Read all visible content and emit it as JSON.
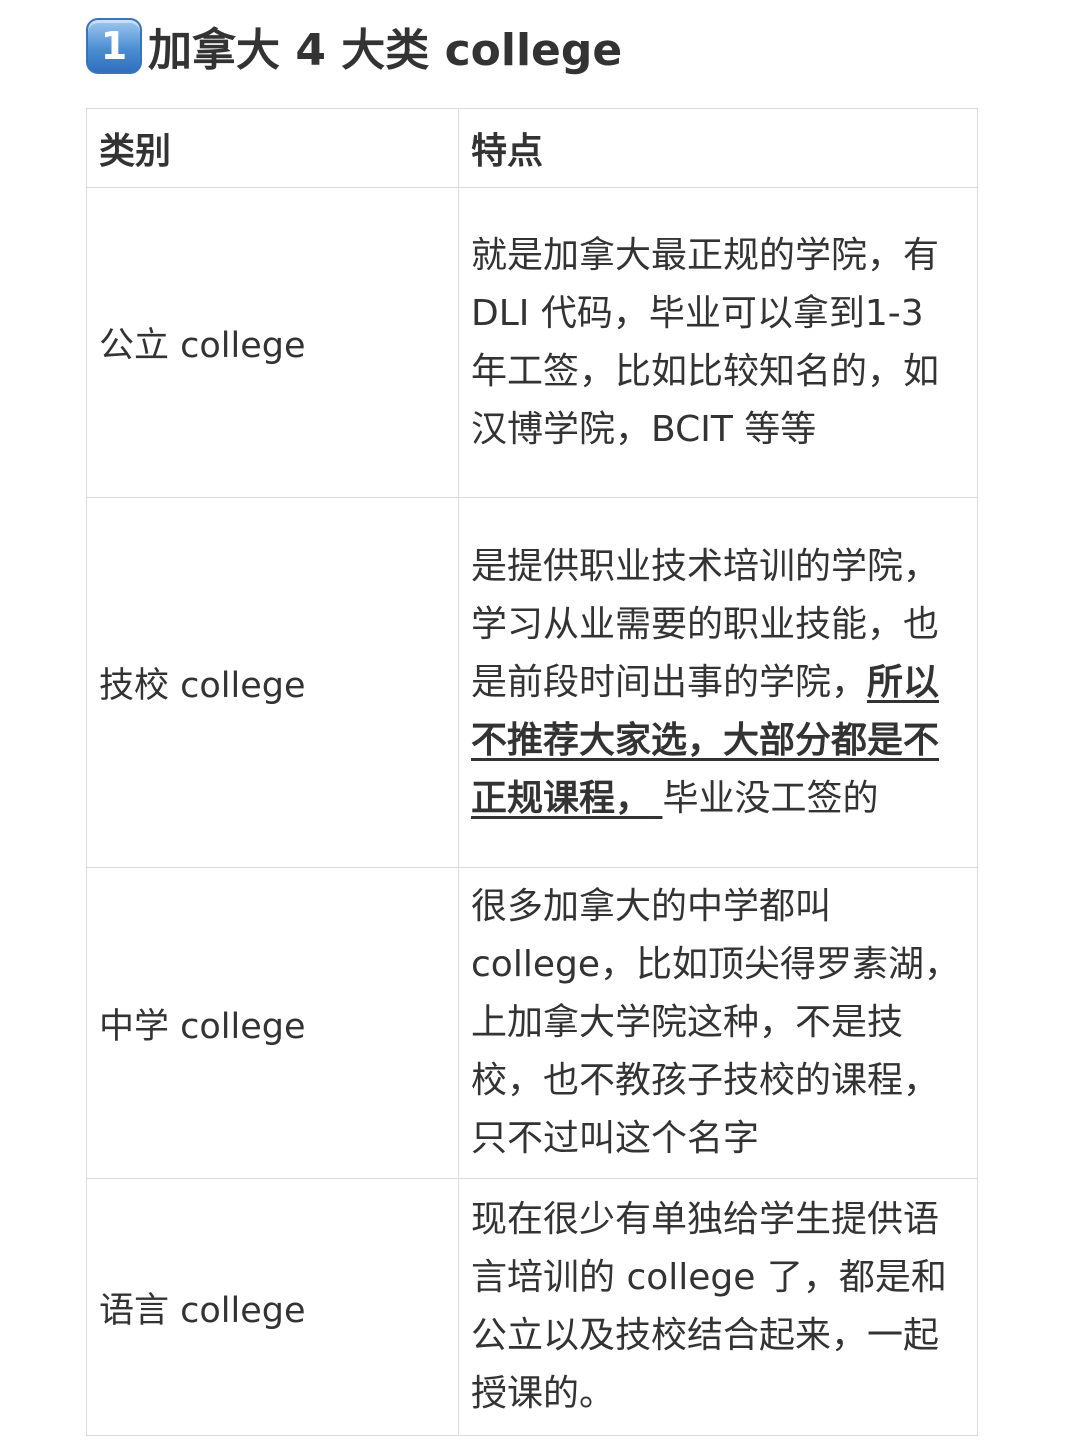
{
  "heading": {
    "number": "1",
    "title": "加拿大 4 大类 college"
  },
  "table": {
    "headers": [
      "类别",
      "特点"
    ],
    "rows": [
      {
        "category": "公立 college",
        "feature": "就是加拿大最正规的学院，有 DLI 代码，毕业可以拿到1-3 年工签，比如比较知名的，如汉博学院，BCIT 等等"
      },
      {
        "category": "技校 college",
        "feature_before": "是提供职业技术培训的学院，学习从业需要的职业技能，也是前段时间出事的学院，",
        "feature_emphasis": "所以不推荐大家选，大部分都是不正规课程，",
        "feature_space": " ",
        "feature_after": "毕业没工签的"
      },
      {
        "category": "中学 college",
        "feature": "很多加拿大的中学都叫 college，比如顶尖得罗素湖，上加拿大学院这种，不是技校，也不教孩子技校的课程，只不过叫这个名字"
      },
      {
        "category": "语言 college",
        "feature": "现在很少有单独给学生提供语言培训的 college 了，都是和公立以及技校结合起来，一起授课的。"
      }
    ]
  }
}
